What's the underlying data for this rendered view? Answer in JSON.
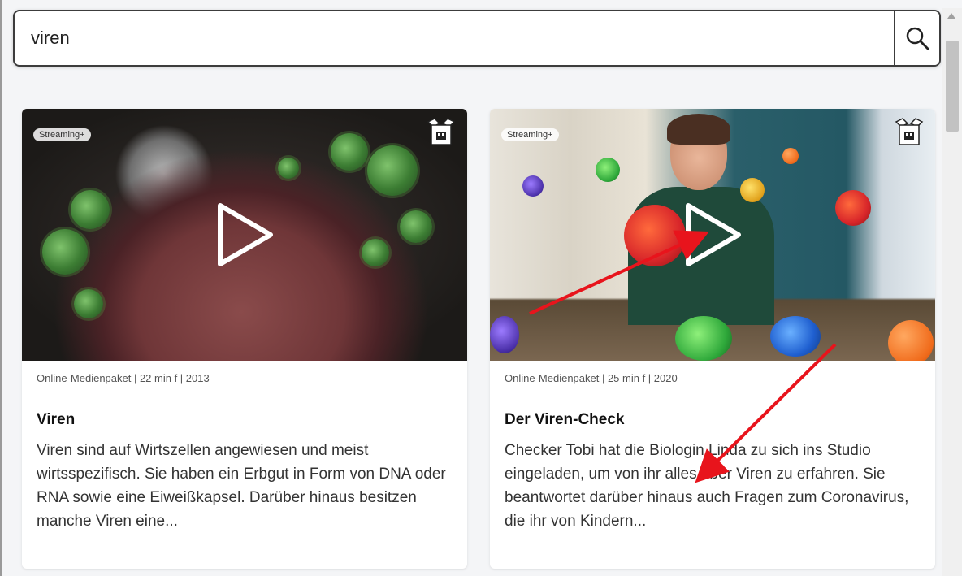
{
  "search": {
    "value": "viren",
    "button_icon": "search-icon"
  },
  "results": [
    {
      "badge": "Streaming+",
      "meta": "Online-Medienpaket | 22 min f | 2013",
      "title": "Viren",
      "description": "Viren sind auf Wirtszellen angewiesen und meist wirtsspezifisch. Sie haben ein Erbgut in Form von DNA oder RNA sowie eine Eiweißkapsel. Darüber hinaus besitzen manche Viren eine...",
      "icons": [
        "play-icon",
        "media-package-icon"
      ]
    },
    {
      "badge": "Streaming+",
      "meta": "Online-Medienpaket | 25 min f | 2020",
      "title": "Der Viren-Check",
      "description": "Checker Tobi hat die Biologin Linda zu sich ins Studio eingeladen, um von ihr alles über Viren zu erfahren. Sie beantwortet darüber hinaus auch Fragen zum Coronavirus, die ihr von Kindern...",
      "icons": [
        "play-icon",
        "media-package-icon"
      ]
    }
  ],
  "annotations": {
    "arrow_color": "#e8141c",
    "arrow_count": 2
  },
  "colors": {
    "page_background": "#f4f5f7",
    "card_background": "#ffffff",
    "search_border": "#3c3c3c"
  }
}
